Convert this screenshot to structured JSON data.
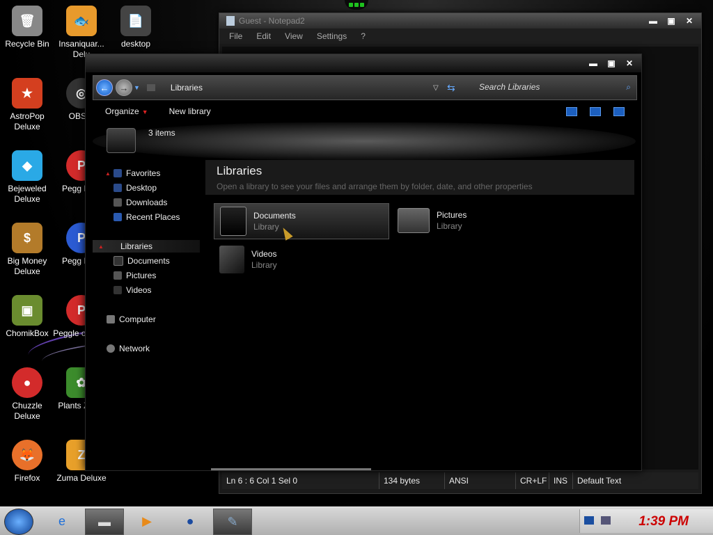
{
  "desktop": {
    "icons": [
      {
        "label": "Recycle Bin",
        "color": "#888888",
        "glyph": "🗑"
      },
      {
        "label": "Insaniquar... Delu",
        "color": "#e89a2c",
        "glyph": "🐟"
      },
      {
        "label": "desktop",
        "color": "#444444",
        "glyph": "📄"
      },
      {
        "label": "AstroPop Deluxe",
        "color": "#d43f1f",
        "glyph": "★"
      },
      {
        "label": "OBS S",
        "color": "#333333",
        "glyph": "◎"
      },
      {
        "label": "Bejeweled Deluxe",
        "color": "#2aa9e6",
        "glyph": "◆"
      },
      {
        "label": "Pegg Delu",
        "color": "#d32b2b",
        "glyph": "P"
      },
      {
        "label": "Big Money Deluxe",
        "color": "#b37b2a",
        "glyph": "$"
      },
      {
        "label": "Pegg Nigh",
        "color": "#2b5bd3",
        "glyph": "P"
      },
      {
        "label": "ChomikBox",
        "color": "#6a8c2f",
        "glyph": "▣"
      },
      {
        "label": "Peggle of Warc",
        "color": "#d32b2b",
        "glyph": "P"
      },
      {
        "label": "Chuzzle Deluxe",
        "color": "#d32b2b",
        "glyph": "●"
      },
      {
        "label": "Plants Zomb",
        "color": "#3c8c2c",
        "glyph": "✿"
      },
      {
        "label": "Firefox",
        "color": "#e8702a",
        "glyph": "🦊"
      },
      {
        "label": "Zuma Deluxe",
        "color": "#e8a02a",
        "glyph": "Z"
      }
    ]
  },
  "notepad": {
    "title": "Guest - Notepad2",
    "menu": [
      "File",
      "Edit",
      "View",
      "Settings",
      "?"
    ],
    "status": {
      "position": "Ln 6 : 6   Col 1   Sel 0",
      "size": "134 bytes",
      "encoding": "ANSI",
      "line_ending": "CR+LF",
      "mode": "INS",
      "scheme": "Default Text"
    }
  },
  "explorer": {
    "address": "Libraries",
    "search_placeholder": "Search Libraries",
    "commands": {
      "organize": "Organize",
      "new_library": "New library"
    },
    "item_count": "3 items",
    "nav": {
      "favorites": {
        "label": "Favorites",
        "items": [
          "Desktop",
          "Downloads",
          "Recent Places"
        ]
      },
      "libraries": {
        "label": "Libraries",
        "items": [
          "Documents",
          "Pictures",
          "Videos"
        ]
      },
      "computer": "Computer",
      "network": "Network"
    },
    "content": {
      "heading": "Libraries",
      "subheading": "Open a library to see your files and arrange them by folder, date, and other properties",
      "items": [
        {
          "name": "Documents",
          "type": "Library"
        },
        {
          "name": "Pictures",
          "type": "Library"
        },
        {
          "name": "Videos",
          "type": "Library"
        }
      ]
    }
  },
  "taskbar": {
    "clock": "1:39 PM"
  },
  "colors": {
    "accent_red": "#cc0000",
    "selection_blue": "#1c5fbf"
  }
}
